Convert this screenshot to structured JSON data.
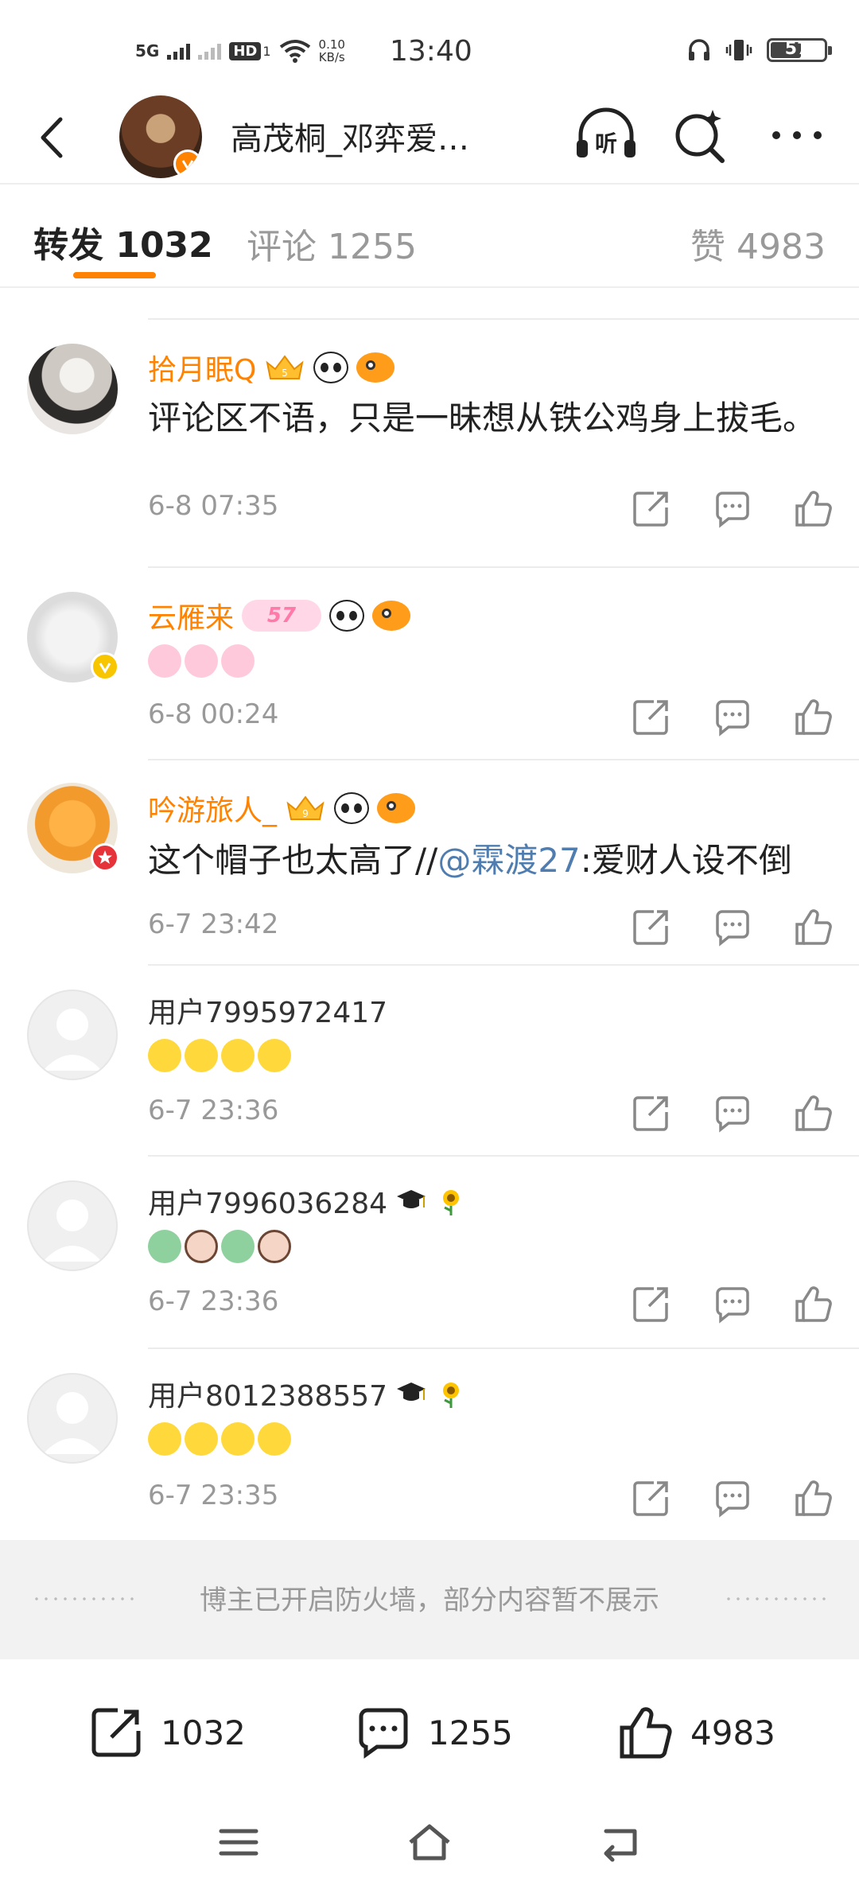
{
  "status_bar": {
    "network": "5G",
    "hd": "HD",
    "hd_sub": "1",
    "speed_value": "0.10",
    "speed_unit": "KB/s",
    "time": "13:40",
    "battery": "57",
    "battery_level": 0.57
  },
  "header": {
    "title": "高茂桐_邓弈爱…",
    "listen_label": "听"
  },
  "tabs": {
    "repost_label": "转发",
    "repost_count": "1032",
    "comment_label": "评论",
    "comment_count": "1255",
    "like_label": "赞",
    "like_count": "4983"
  },
  "items": [
    {
      "username": "拾月眠Q",
      "text": "评论区不语，只是一昧想从铁公鸡身上拔毛。",
      "time": "6-8 07:35",
      "avatar_color": "#e9e5e2"
    },
    {
      "username": "云雁来",
      "level_tag": "57",
      "time": "6-8 00:24",
      "avatar_color": "#e8e8e8",
      "verified_color": "#f7c600"
    },
    {
      "username": "吟游旅人_",
      "text_before": "这个帽子也太高了//",
      "mention": "@霖渡27",
      "text_after": ":爱财人设不倒",
      "time": "6-7 23:42",
      "avatar_color": "#f39a2d",
      "verified_color": "#e6333a"
    },
    {
      "username": "用户7995972417",
      "time": "6-7 23:36"
    },
    {
      "username": "用户7996036284",
      "time": "6-7 23:36"
    },
    {
      "username": "用户8012388557",
      "time": "6-7 23:35"
    }
  ],
  "firewall_notice": "博主已开启防火墙，部分内容暂不展示",
  "bottom_bar": {
    "repost_count": "1032",
    "comment_count": "1255",
    "like_count": "4983"
  },
  "colors": {
    "accent": "#ff8200",
    "mention": "#507daf",
    "muted": "#999999"
  }
}
